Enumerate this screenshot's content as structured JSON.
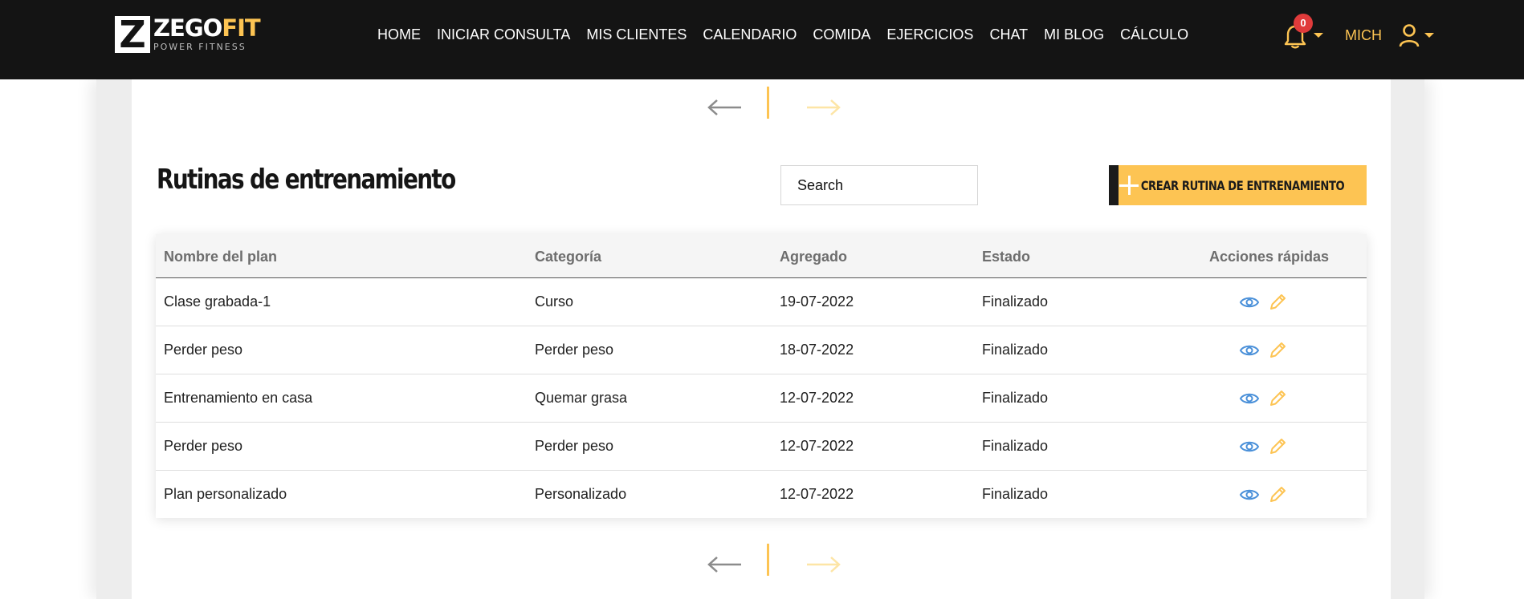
{
  "brand": {
    "name_white": "ZEGO",
    "name_yellow": "FIT",
    "tagline": "POWER FITNESS",
    "letter": "Z"
  },
  "nav": [
    "HOME",
    "INICIAR CONSULTA",
    "MIS CLIENTES",
    "CALENDARIO",
    "COMIDA",
    "EJERCICIOS",
    "CHAT",
    "MI BLOG",
    "CÁLCULO"
  ],
  "notifications": {
    "count": "0",
    "icon": "bell-icon"
  },
  "user": {
    "name": "MICH",
    "icon": "user-icon"
  },
  "page": {
    "title": "Rutinas de entrenamiento",
    "search_placeholder": "Search",
    "create_label": "CREAR RUTINA DE ENTRENAMIENTO"
  },
  "pager": {
    "prev": "←",
    "next": "→"
  },
  "table": {
    "headers": [
      "Nombre del plan",
      "Categoría",
      "Agregado",
      "Estado",
      "Acciones rápidas"
    ],
    "rows": [
      [
        "Clase grabada-1",
        "Curso",
        "19-07-2022",
        "Finalizado"
      ],
      [
        "Perder peso",
        "Perder peso",
        "18-07-2022",
        "Finalizado"
      ],
      [
        "Entrenamiento en casa",
        "Quemar grasa",
        "12-07-2022",
        "Finalizado"
      ],
      [
        "Perder peso",
        "Perder peso",
        "12-07-2022",
        "Finalizado"
      ],
      [
        "Plan personalizado",
        "Personalizado",
        "12-07-2022",
        "Finalizado"
      ]
    ]
  },
  "colors": {
    "accent": "#fdc453",
    "dark": "#141414",
    "view_icon": "#4a90d9",
    "badge": "#e03b3b"
  }
}
